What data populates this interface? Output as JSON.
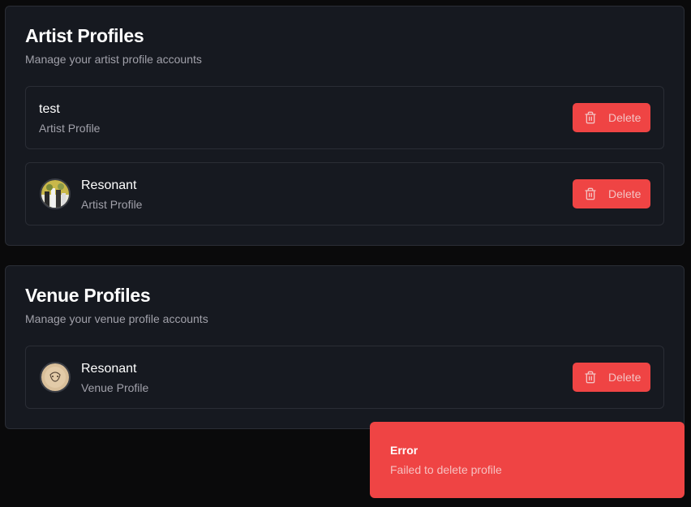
{
  "artist_section": {
    "title": "Artist Profiles",
    "subtitle": "Manage your artist profile accounts",
    "profiles": [
      {
        "name": "test",
        "type": "Artist Profile",
        "delete_label": "Delete"
      },
      {
        "name": "Resonant",
        "type": "Artist Profile",
        "delete_label": "Delete"
      }
    ]
  },
  "venue_section": {
    "title": "Venue Profiles",
    "subtitle": "Manage your venue profile accounts",
    "profiles": [
      {
        "name": "Resonant",
        "type": "Venue Profile",
        "delete_label": "Delete"
      }
    ]
  },
  "toast": {
    "title": "Error",
    "message": "Failed to delete profile"
  },
  "colors": {
    "background": "#0a0a0b",
    "card": "#161920",
    "border": "#2a2d35",
    "danger": "#ef4444"
  },
  "icons": {
    "delete": "trash-icon"
  }
}
